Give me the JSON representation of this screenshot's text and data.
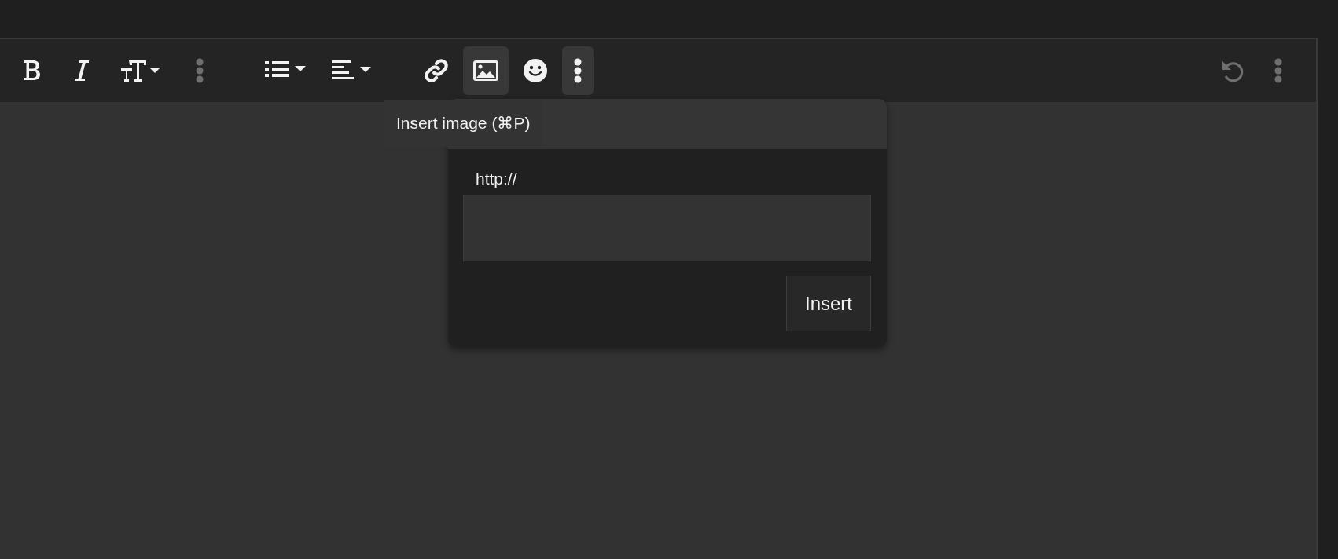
{
  "toolbar": {
    "groups": [
      {
        "items": [
          {
            "kind": "bold",
            "active": false,
            "disabled": false
          },
          {
            "kind": "italic",
            "active": false,
            "disabled": false
          },
          {
            "kind": "text-size",
            "active": false,
            "disabled": false
          },
          {
            "kind": "more",
            "active": false,
            "disabled": true
          }
        ]
      },
      {
        "items": [
          {
            "kind": "list",
            "active": false,
            "disabled": false
          },
          {
            "kind": "align",
            "active": false,
            "disabled": false
          }
        ]
      },
      {
        "items": [
          {
            "kind": "link",
            "active": false,
            "disabled": false
          },
          {
            "kind": "image",
            "active": true,
            "disabled": false
          },
          {
            "kind": "emoji",
            "active": false,
            "disabled": false
          },
          {
            "kind": "more",
            "active": true,
            "disabled": false
          }
        ]
      }
    ],
    "trailing": [
      {
        "kind": "undo",
        "active": false,
        "disabled": true
      },
      {
        "kind": "more",
        "active": false,
        "disabled": true
      }
    ]
  },
  "tooltip": {
    "text": "Insert image (⌘P)"
  },
  "image_dialog": {
    "label": "http://",
    "insert_button": "Insert"
  }
}
